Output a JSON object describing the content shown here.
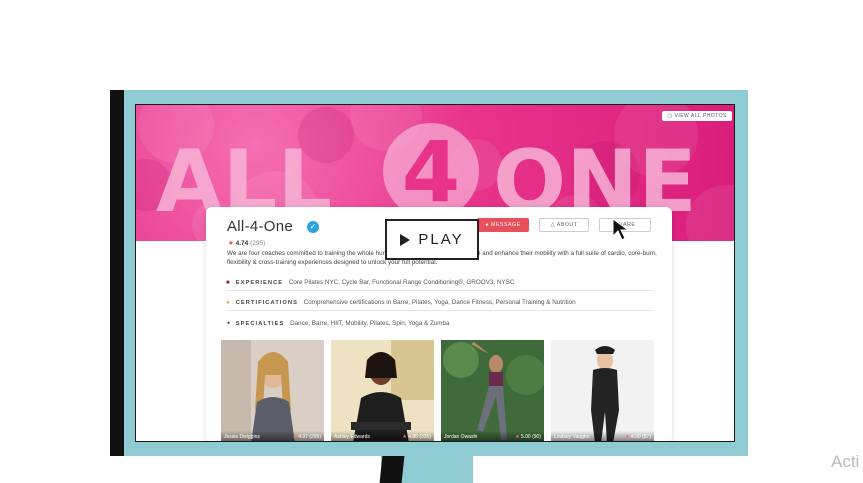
{
  "colors": {
    "monitor": "#8ecbd3",
    "banner": "#e8338b",
    "accent": "#e8505b",
    "verified": "#2aa4e0"
  },
  "banner": {
    "title_left": "ALL",
    "title_number": "4",
    "title_right": "ONE",
    "view_photos_label": "VIEW ALL PHOTOS"
  },
  "profile": {
    "name": "All-4-One",
    "verified_icon": "check-icon",
    "rating_value": "4.74",
    "rating_count": "(295)",
    "bio": "We are four coaches committed to training the whole human! We help clients build strength and enhance their mobility with a full suite of cardio, core-burn, flexibility & cross-training experiences designed to unlock your full potential.",
    "buttons": {
      "message": "MESSAGE",
      "about": "ABOUT",
      "share": "SHARE"
    }
  },
  "info": {
    "experience_label": "EXPERIENCE",
    "experience_value": "Core Pilates NYC, Cycle Bar, Functional Range Conditioning®, GROOV3, NYSC",
    "certifications_label": "CERTIFICATIONS",
    "certifications_value": "Comprehensive certifications in Barre, Pilates, Yoga, Dance Fitness, Personal Training & Nutrition",
    "specialties_label": "SPECIALTIES",
    "specialties_value": "Dance, Barre, HIIT, Mobility, Pilates, Spin, Yoga & Zumba"
  },
  "coaches": [
    {
      "name": "Jessie Dwiggins",
      "rating": "4.97 (295)"
    },
    {
      "name": "Ashley Edwards",
      "rating": "4.86 (335)"
    },
    {
      "name": "Jordan Owashi",
      "rating": "5.00 (90)"
    },
    {
      "name": "Lindsey Vaughn",
      "rating": "4.90 (87)"
    }
  ],
  "overlay": {
    "play_label": "PLAY"
  },
  "watermark": "Acti"
}
